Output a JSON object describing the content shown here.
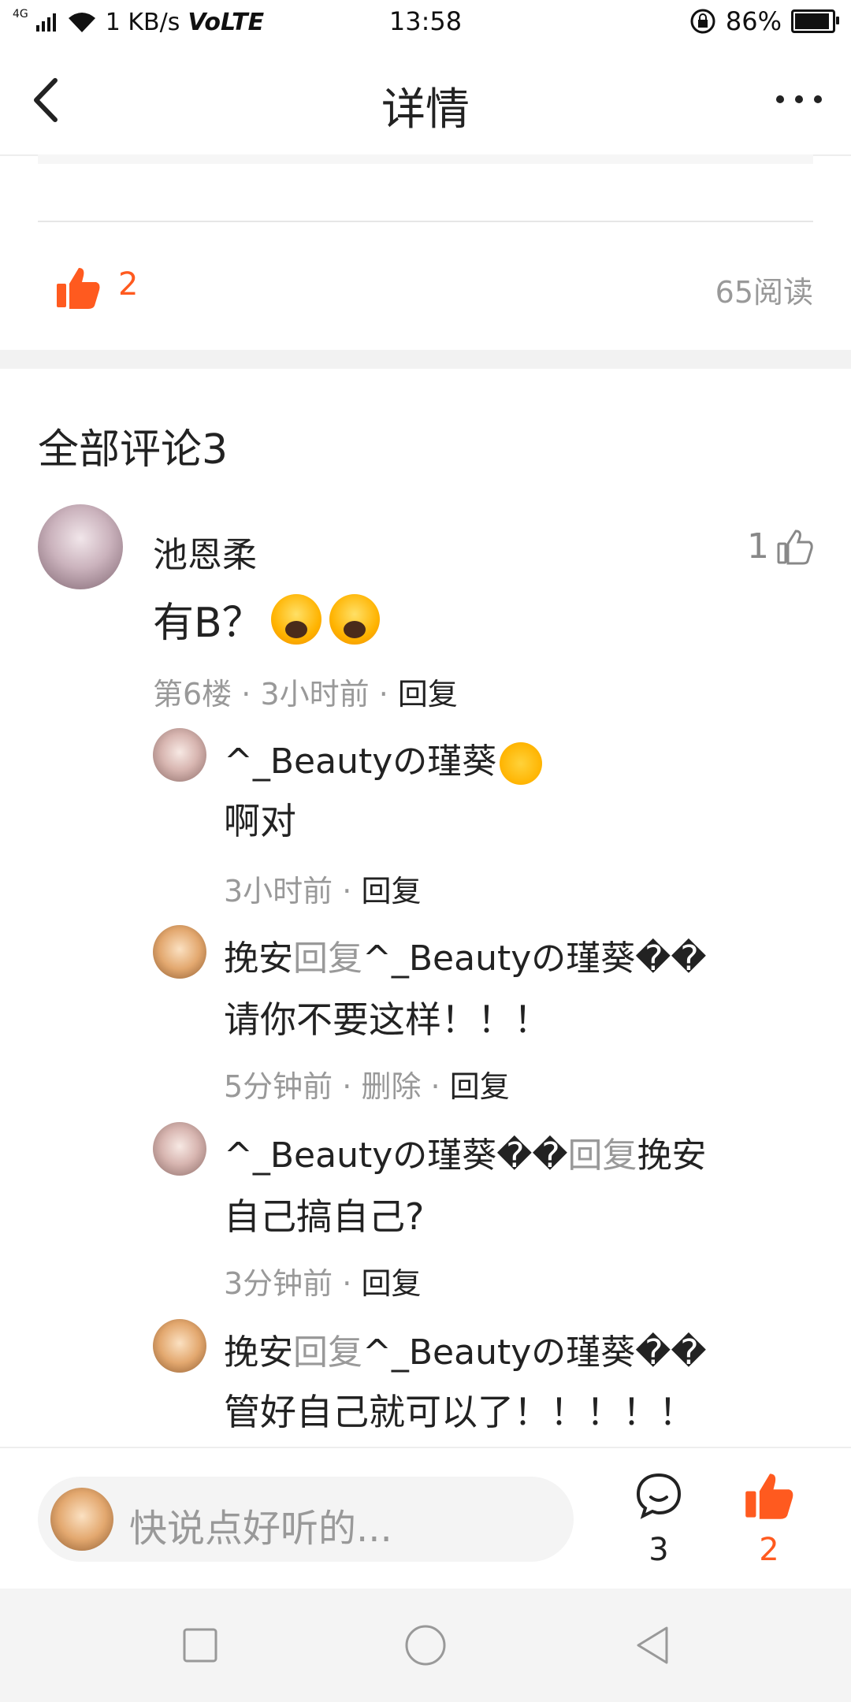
{
  "status_bar": {
    "network": "4G",
    "speed": "1 KB/s",
    "volte": "VoLTE",
    "time": "13:58",
    "battery": "86%",
    "battery_level": 0.86
  },
  "header": {
    "title": "详情"
  },
  "post_stats": {
    "likes": "2",
    "reads": "65阅读"
  },
  "comments": {
    "title": "全部评论3",
    "main": {
      "author": "池恩柔",
      "like_count": "1",
      "text": "有B？",
      "floor": "第6楼",
      "time": "3小时前",
      "reply_label": "回复"
    },
    "replies": [
      {
        "author": "^_Beautyの瑾葵",
        "reply_word": "",
        "reply_to": "",
        "text": "啊对",
        "time": "3小时前",
        "delete_label": "",
        "reply_label": "回复"
      },
      {
        "author": "挽安",
        "reply_word": "回复",
        "reply_to": "^_Beautyの瑾葵��",
        "text": "请你不要这样！！！",
        "time": "5分钟前",
        "delete_label": "删除",
        "reply_label": "回复"
      },
      {
        "author": "^_Beautyの瑾葵��",
        "reply_word": "回复",
        "reply_to": "挽安",
        "text": "自己搞自己?",
        "time": "3分钟前",
        "delete_label": "",
        "reply_label": "回复"
      },
      {
        "author": "挽安",
        "reply_word": "回复",
        "reply_to": "^_Beautyの瑾葵��",
        "text": "管好自己就可以了！！！！！",
        "time": "",
        "delete_label": "",
        "reply_label": ""
      }
    ]
  },
  "bottom_bar": {
    "placeholder": "快说点好听的...",
    "comment_count": "3",
    "like_count": "2"
  },
  "colors": {
    "accent": "#ff5a1f",
    "muted": "#999999",
    "text": "#222222"
  }
}
